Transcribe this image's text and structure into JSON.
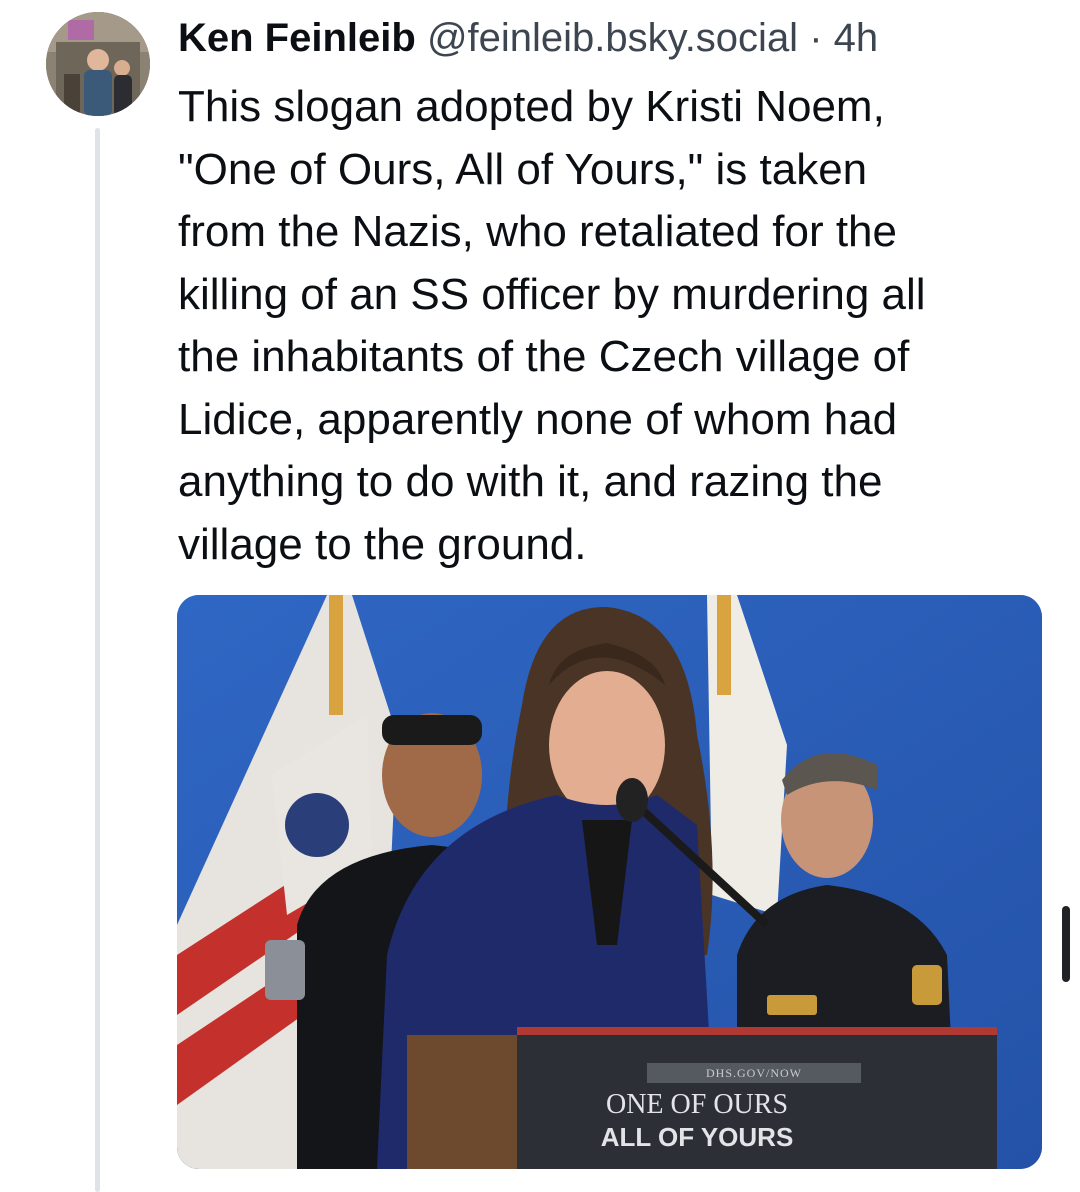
{
  "post": {
    "author": {
      "display_name": "Ken Feinleib",
      "handle": "@feinleib.bsky.social",
      "separator": "·",
      "timestamp": "4h"
    },
    "text": "This slogan adopted by Kristi Noem,\n\"One of Ours, All of Yours,\" is taken\nfrom the Nazis, who retaliated for the\nkilling of an SS officer by murdering all\nthe inhabitants of the Czech village of\nLidice, apparently none of whom had\nanything to do with it, and razing the\nvillage to the ground.",
    "image": {
      "sign_small_text": "DHS.GOV/NOW",
      "sign_line1": "ONE OF OURS",
      "sign_line2": "ALL OF YOURS"
    }
  },
  "icons": {
    "scrollbar": "scrollbar-thumb"
  }
}
